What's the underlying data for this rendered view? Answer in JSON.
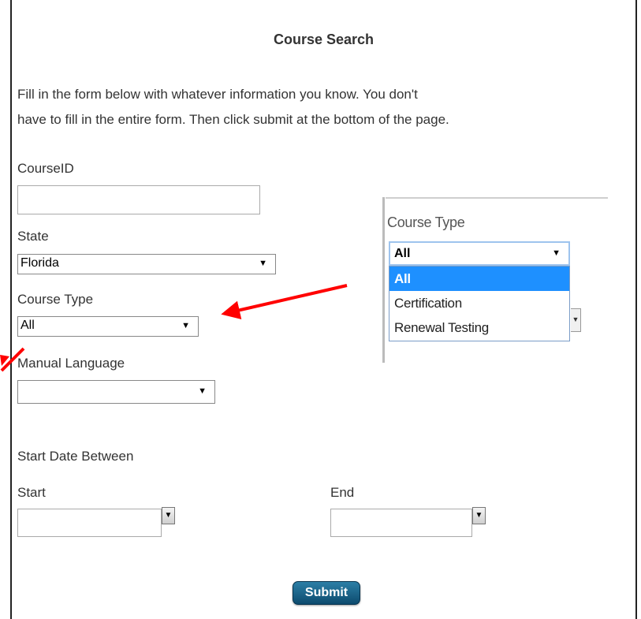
{
  "header": {
    "title": "Course Search"
  },
  "intro": {
    "line1": "Fill in the form below with whatever information you know. You don't",
    "line2": "have to fill in the entire form. Then click submit at the bottom of the page."
  },
  "form": {
    "course_id": {
      "label": "CourseID",
      "value": ""
    },
    "state": {
      "label": "State",
      "selected": "Florida"
    },
    "course_type": {
      "label": "Course Type",
      "selected": "All"
    },
    "manual_language": {
      "label": "Manual Language",
      "selected": ""
    },
    "date_range": {
      "heading": "Start Date Between",
      "start_label": "Start",
      "end_label": "End",
      "start_value": "",
      "end_value": ""
    },
    "submit_label": "Submit"
  },
  "inset": {
    "label": "Course Type",
    "selected": "All",
    "options": [
      "All",
      "Certification",
      "Renewal Testing"
    ],
    "highlighted_option": "All"
  },
  "icons": {
    "dropdown_arrow": "▼",
    "annotation_arrow_color": "#ff0000"
  }
}
